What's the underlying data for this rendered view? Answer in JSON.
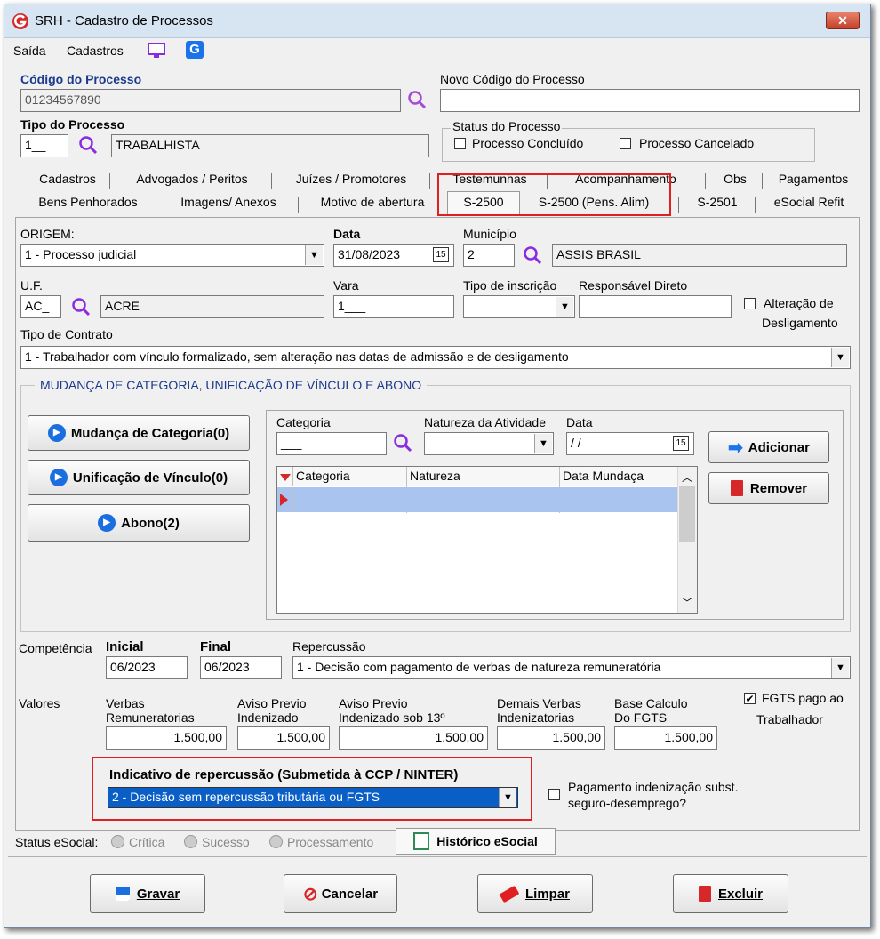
{
  "window": {
    "title": "SRH - Cadastro de Processos"
  },
  "menu": {
    "saida": "Saída",
    "cadastros": "Cadastros"
  },
  "header": {
    "codigo_label": "Código do Processo",
    "codigo_value": "01234567890",
    "novo_codigo_label": "Novo Código do Processo",
    "novo_codigo_value": "",
    "tipo_label": "Tipo do Processo",
    "tipo_code": "1__",
    "tipo_desc": "TRABALHISTA",
    "status_label": "Status do Processo",
    "concluido_label": "Processo Concluído",
    "cancelado_label": "Processo Cancelado"
  },
  "tabs_row1": [
    "Cadastros",
    "Advogados / Peritos",
    "Juízes / Promotores",
    "Testemunhas",
    "Acompanhamento",
    "Obs",
    "Pagamentos"
  ],
  "tabs_row2": [
    "Bens Penhorados",
    "Imagens/ Anexos",
    "Motivo de abertura",
    "S-2500",
    "S-2500 (Pens. Alim)",
    "S-2501",
    "eSocial Refit"
  ],
  "form": {
    "origem_label": "ORIGEM:",
    "origem_value": "1 - Processo judicial",
    "data_label": "Data",
    "data_value": "31/08/2023",
    "calendar_day": "15",
    "municipio_label": "Município",
    "municipio_code": "2____",
    "municipio_desc": "ASSIS BRASIL",
    "uf_label": "U.F.",
    "uf_code": "AC_",
    "uf_desc": "ACRE",
    "vara_label": "Vara",
    "vara_value": "1___",
    "tipo_inscricao_label": "Tipo de inscrição",
    "tipo_inscricao_value": "",
    "responsavel_label": "Responsável Direto",
    "responsavel_value": "",
    "alteracao_label_1": "Alteração de",
    "alteracao_label_2": "Desligamento",
    "tipo_contrato_label": "Tipo de Contrato",
    "tipo_contrato_value": "1 - Trabalhador com vínculo formalizado, sem alteração nas datas de admissão e de desligamento"
  },
  "mudanca": {
    "group_title": "MUDANÇA DE CATEGORIA, UNIFICAÇÃO DE VÍNCULO E ABONO",
    "btn_mudanca": "Mudança de Categoria(0)",
    "btn_unificacao": "Unificação de Vínculo(0)",
    "btn_abono": "Abono(2)",
    "categoria_label": "Categoria",
    "categoria_value": "___",
    "natureza_label": "Natureza da Atividade",
    "natureza_value": "",
    "data_label": "Data",
    "data_value": " / /",
    "calendar_day": "15",
    "btn_adicionar": "Adicionar",
    "btn_remover": "Remover",
    "grid_headers": [
      "Categoria",
      "Natureza",
      "Data Mundaça"
    ]
  },
  "competencia": {
    "label": "Competência",
    "inicial_label": "Inicial",
    "inicial_value": "06/2023",
    "final_label": "Final",
    "final_value": "06/2023",
    "repercussao_label": "Repercussão",
    "repercussao_value": "1 - Decisão com pagamento de verbas de natureza remuneratória"
  },
  "valores": {
    "label": "Valores",
    "verbas_label_1": "Verbas",
    "verbas_label_2": "Remuneratorias",
    "verbas_value": "1.500,00",
    "aviso_label_1": "Aviso Previo",
    "aviso_label_2": "Indenizado",
    "aviso_value": "1.500,00",
    "aviso13_label_1": "Aviso Previo",
    "aviso13_label_2": "Indenizado sob 13º",
    "aviso13_value": "1.500,00",
    "demais_label_1": "Demais Verbas",
    "demais_label_2": "Indenizatorias",
    "demais_value": "1.500,00",
    "base_label_1": "Base Calculo",
    "base_label_2": "Do FGTS",
    "base_value": "1.500,00",
    "fgts_label_1": "FGTS pago ao",
    "fgts_label_2": "Trabalhador"
  },
  "indicativo": {
    "label": "Indicativo de repercussão (Submetida à CCP / NINTER)",
    "value": "2 - Decisão sem repercussão tributária ou FGTS",
    "pagamento_label_1": "Pagamento indenização subst.",
    "pagamento_label_2": "seguro-desemprego?"
  },
  "status": {
    "label": "Status eSocial:",
    "critica": "Crítica",
    "sucesso": "Sucesso",
    "processamento": "Processamento",
    "historico": "Histórico eSocial"
  },
  "footer": {
    "gravar": "Gravar",
    "cancelar": "Cancelar",
    "limpar": "Limpar",
    "excluir": "Excluir"
  },
  "colors": {
    "highlight_red": "#e02020",
    "selection_blue": "#0a5fc7",
    "row_blue": "#a9c4ef",
    "accent_blue": "#1a73e8"
  }
}
